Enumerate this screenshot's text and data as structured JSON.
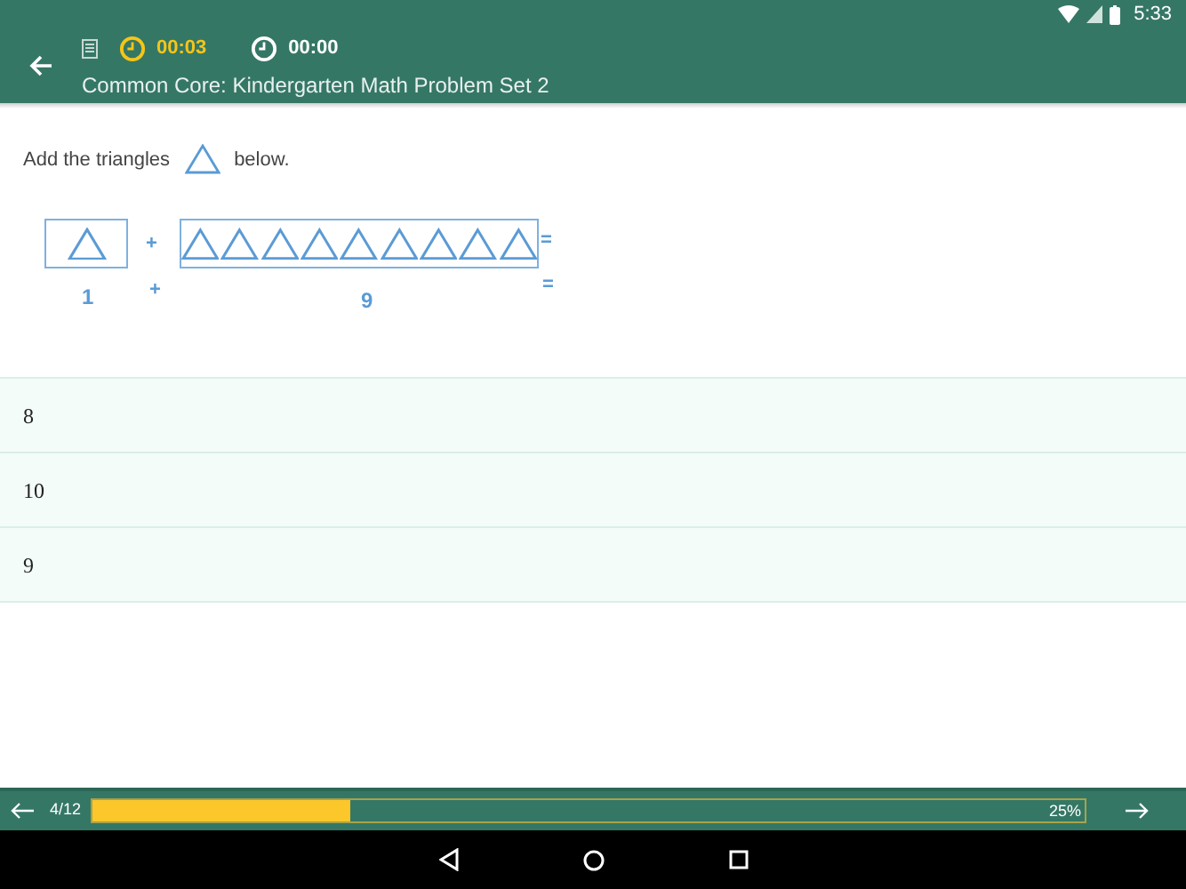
{
  "status_bar": {
    "time": "5:33"
  },
  "header": {
    "timer_elapsed": "00:03",
    "timer_total": "00:00",
    "title": "Common Core: Kindergarten Math Problem Set 2"
  },
  "question": {
    "before": "Add the triangles",
    "after": "below.",
    "groups": [
      {
        "shapes": [
          {
            "kind": "triangle"
          }
        ],
        "label": "1"
      },
      {
        "shapes": [
          {
            "kind": "triangle"
          },
          {
            "kind": "triangle"
          },
          {
            "kind": "triangle"
          },
          {
            "kind": "triangle"
          },
          {
            "kind": "triangle"
          },
          {
            "kind": "triangle"
          },
          {
            "kind": "triangle"
          },
          {
            "kind": "triangle"
          },
          {
            "kind": "triangle"
          }
        ],
        "label": "9"
      }
    ],
    "plus": "+",
    "equals": "="
  },
  "answers": [
    {
      "text": "8"
    },
    {
      "text": "10"
    },
    {
      "text": "9"
    }
  ],
  "progress": {
    "position": "4/12",
    "level": 0.26,
    "percent": "25%"
  }
}
